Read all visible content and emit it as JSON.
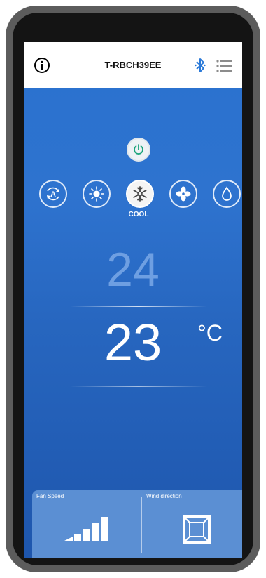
{
  "header": {
    "title": "T-RBCH39EE"
  },
  "modes": [
    {
      "name": "auto",
      "icon": "auto-mode-icon"
    },
    {
      "name": "heat",
      "icon": "sun-icon"
    },
    {
      "name": "cool",
      "icon": "snowflake-icon",
      "active": true
    },
    {
      "name": "fan",
      "icon": "fan-icon"
    },
    {
      "name": "dry",
      "icon": "water-drop-icon"
    }
  ],
  "selected_mode_label": "COOL",
  "temperature": {
    "setpoint": "24",
    "current": "23",
    "unit": "°C"
  },
  "panel": {
    "fan_speed_label": "Fan Speed",
    "wind_direction_label": "Wind direction",
    "fan_speed_level": 1.0
  },
  "colors": {
    "accent": "#2e73cf",
    "power_green": "#1aa37a"
  }
}
